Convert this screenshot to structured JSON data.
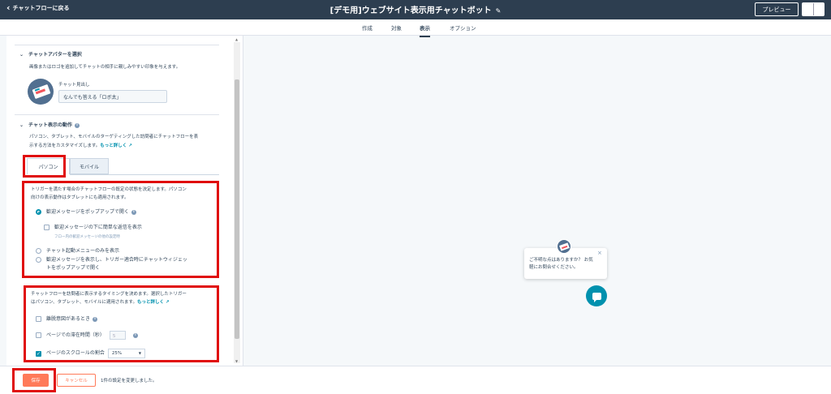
{
  "header": {
    "back_label": "チャットフローに戻る",
    "title": "[デモ用]ウェブサイト表示用チャットボット",
    "preview_label": "プレビュー"
  },
  "tabs": [
    {
      "label": "作成"
    },
    {
      "label": "対象"
    },
    {
      "label": "表示"
    },
    {
      "label": "オプション"
    }
  ],
  "active_tab": "表示",
  "avatar_section": {
    "title": "チャットアバターを選択",
    "description": "画像またはロゴを追加してチャットの相手に親しみやすい印象を与えます。",
    "heading_label": "チャット見出し",
    "heading_value": "なんでも答える「ロボ太」"
  },
  "behavior_section": {
    "title": "チャット表示の動作",
    "description_line1": "パソコン、タブレット、モバイルのターゲティングした訪問者にチャットフローを表",
    "description_line2": "示する方法をカスタマイズします。",
    "learn_more": "もっと詳しく",
    "subtabs": [
      {
        "label": "パソコン"
      },
      {
        "label": "モバイル"
      }
    ],
    "trigger_desc_line1": "トリガーを満たす場合のチャットフローの既定の状態を決定します。パソコン",
    "trigger_desc_line2": "向けの表示動作はタブレットにも適用されます。",
    "options": {
      "popup": "歓迎メッセージをポップアップで開く",
      "sub_checkbox": "歓迎メッセージの下に簡単な返信を表示",
      "sub_hint": "フロー内の歓迎メッセージの他の設定時",
      "launcher_only": "チャット起動メニューのみを表示",
      "show_then_popup_line1": "歓迎メッセージを表示し、トリガー適合時にチャットウィジェッ",
      "show_then_popup_line2": "トをポップアップで開く"
    },
    "selected_option": "popup",
    "timing_desc_line1": "チャットフローを訪問者に表示するタイミングを決めます。選択したトリガー",
    "timing_desc_line2": "はパソコン、タブレット、モバイルに適用されます。",
    "timing_learn_more": "もっと詳しく",
    "timing_options": {
      "exit_intent": "離脱意図があるとき",
      "time_on_page": "ページでの滞在時間（秒）",
      "time_value": "5",
      "scroll": "ページのスクロールの割合",
      "scroll_value": "25%"
    }
  },
  "footer": {
    "save_label": "保存",
    "cancel_label": "キャンセル",
    "note": "1件の設定を変更しました。"
  },
  "preview": {
    "bubble_text_line1": "ご不明な点はありますか？ お気",
    "bubble_text_line2": "軽にお問合せください。"
  },
  "colors": {
    "header_bg": "#2d3e50",
    "accent": "#0091ae",
    "save": "#ff7a59",
    "highlight": "#e00d0d"
  }
}
